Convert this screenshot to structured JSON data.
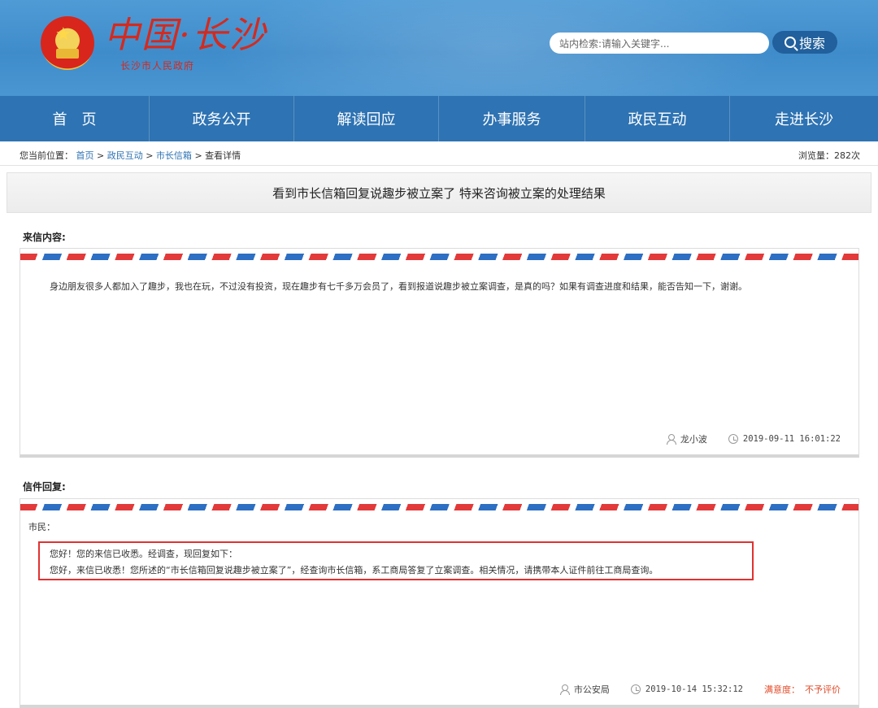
{
  "header": {
    "logo_text": "中国·长沙",
    "logo_subtitle": "长沙市人民政府",
    "search_placeholder": "站内检索:请输入关键字...",
    "search_button": "搜索"
  },
  "nav": {
    "items": [
      {
        "label": "首　页"
      },
      {
        "label": "政务公开"
      },
      {
        "label": "解读回应"
      },
      {
        "label": "办事服务"
      },
      {
        "label": "政民互动"
      },
      {
        "label": "走进长沙"
      }
    ]
  },
  "breadcrumb": {
    "prefix": "您当前位置：",
    "items": [
      "首页",
      "政民互动",
      "市长信箱"
    ],
    "separator": ">",
    "current": "查看详情",
    "views_label": "浏览量：",
    "views_count": "282次"
  },
  "letter": {
    "title": "看到市长信箱回复说趣步被立案了 特来咨询被立案的处理结果",
    "incoming_label": "来信内容:",
    "incoming_text": "身边朋友很多人都加入了趣步，我也在玩，不过没有投资，现在趣步有七千多万会员了，看到报道说趣步被立案调查，是真的吗？如果有调查进度和结果，能否告知一下，谢谢。",
    "author": "龙小波",
    "submitted_time": "2019-09-11 16:01:22"
  },
  "reply": {
    "label": "信件回复:",
    "salutation": "市民：",
    "line1": "您好！您的来信已收悉。经调查，现回复如下：",
    "line2": "您好，来信已收悉！您所述的“市长信箱回复说趣步被立案了”，经查询市长信箱，系工商局答复了立案调查。相关情况，请携带本人证件前往工商局查询。",
    "department": "市公安局",
    "reply_time": "2019-10-14 15:32:12",
    "satisfaction_label": "满意度：",
    "satisfaction_value": "不予评价"
  },
  "colors": {
    "header_blue": "#4a96d2",
    "nav_blue": "#2e73b3",
    "logo_red": "#d42a1e",
    "highlight_red": "#e03232",
    "satisfaction_orange": "#e24b2a"
  }
}
